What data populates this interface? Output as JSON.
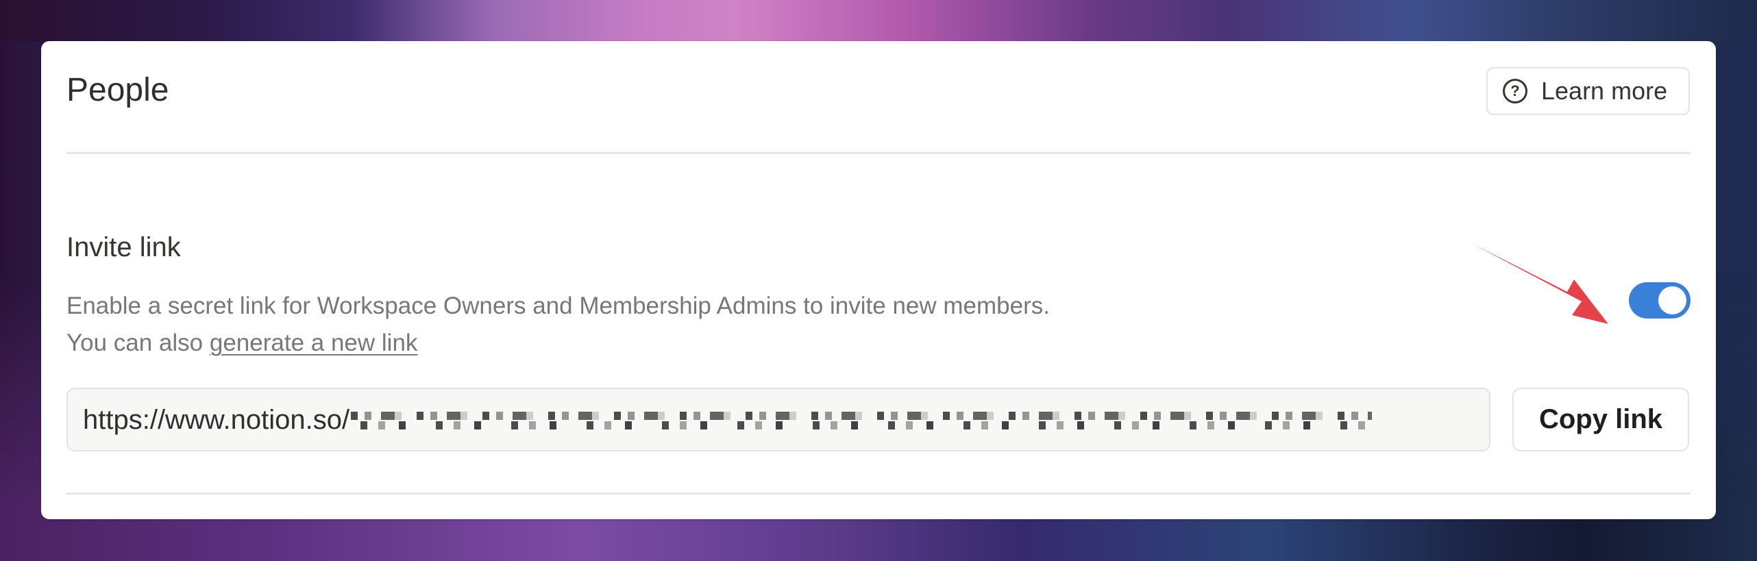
{
  "header": {
    "title": "People",
    "learn_more": {
      "icon": "help-circle-icon",
      "label": "Learn more"
    }
  },
  "invite_link": {
    "title": "Invite link",
    "description": "Enable a secret link for Workspace Owners and Membership Admins to invite new members.",
    "also_prefix": "You can also ",
    "generate_link_label": "generate a new link",
    "toggle": {
      "enabled": true,
      "color": "#3a7fd8"
    },
    "url_field": {
      "value_visible": "https://www.notion.so/",
      "value_redacted": true
    },
    "copy_button_label": "Copy link"
  },
  "annotation": {
    "type": "arrow",
    "color": "#e5414a",
    "points_to": "invite-link-toggle"
  }
}
